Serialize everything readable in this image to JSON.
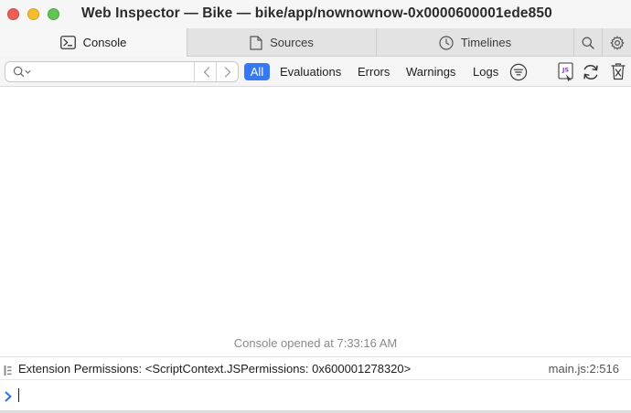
{
  "window": {
    "title": "Web Inspector — Bike — bike/app/nownownow-0x0000600001ede850"
  },
  "tabs": [
    {
      "label": "Console",
      "icon": "console-icon",
      "selected": true
    },
    {
      "label": "Sources",
      "icon": "sources-icon",
      "selected": false
    },
    {
      "label": "Timelines",
      "icon": "timelines-icon",
      "selected": false
    }
  ],
  "tab_tools": {
    "search_icon": "search-icon",
    "settings_icon": "gear-icon"
  },
  "filter_bar": {
    "search_placeholder": "",
    "filters": [
      {
        "label": "All",
        "selected": true
      },
      {
        "label": "Evaluations",
        "selected": false
      },
      {
        "label": "Errors",
        "selected": false
      },
      {
        "label": "Warnings",
        "selected": false
      },
      {
        "label": "Logs",
        "selected": false
      }
    ],
    "icons": [
      "filter-menu-icon",
      "javascript-context-icon",
      "reload-icon",
      "clear-log-icon"
    ]
  },
  "console": {
    "session_text": "Console opened at 7:33:16 AM",
    "messages": [
      {
        "text": "Extension Permissions: <ScriptContext.JSPermissions: 0x600001278320>",
        "location": "main.js:2:516"
      }
    ],
    "prompt_value": ""
  },
  "colors": {
    "accent": "#3478f6",
    "titlebar": "#f6f6f6",
    "tabbar": "#e3e3e3",
    "close": "#ec5f58",
    "minimize": "#f5bd2e",
    "maximize": "#61c454"
  }
}
